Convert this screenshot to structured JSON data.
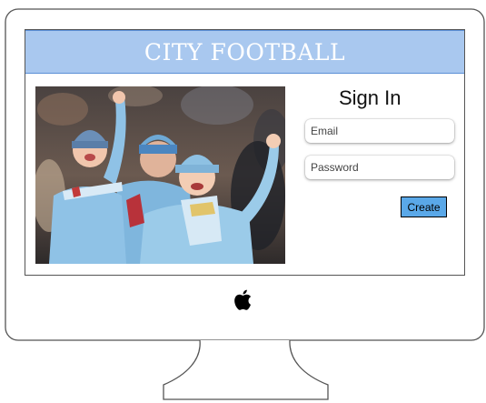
{
  "header": {
    "title": "CITY FOOTBALL"
  },
  "hero": {
    "image_desc": "fans-photo"
  },
  "signin": {
    "title": "Sign In",
    "email_placeholder": "Email",
    "password_placeholder": "Password",
    "create_label": "Create"
  },
  "colors": {
    "header_bg": "#a9c8ef",
    "header_border": "#5b8fd6",
    "header_text": "#ffffff",
    "button_bg": "#5aa8e8",
    "monitor_outline": "#555555"
  },
  "icons": {
    "brand_logo": "apple-logo-icon"
  }
}
